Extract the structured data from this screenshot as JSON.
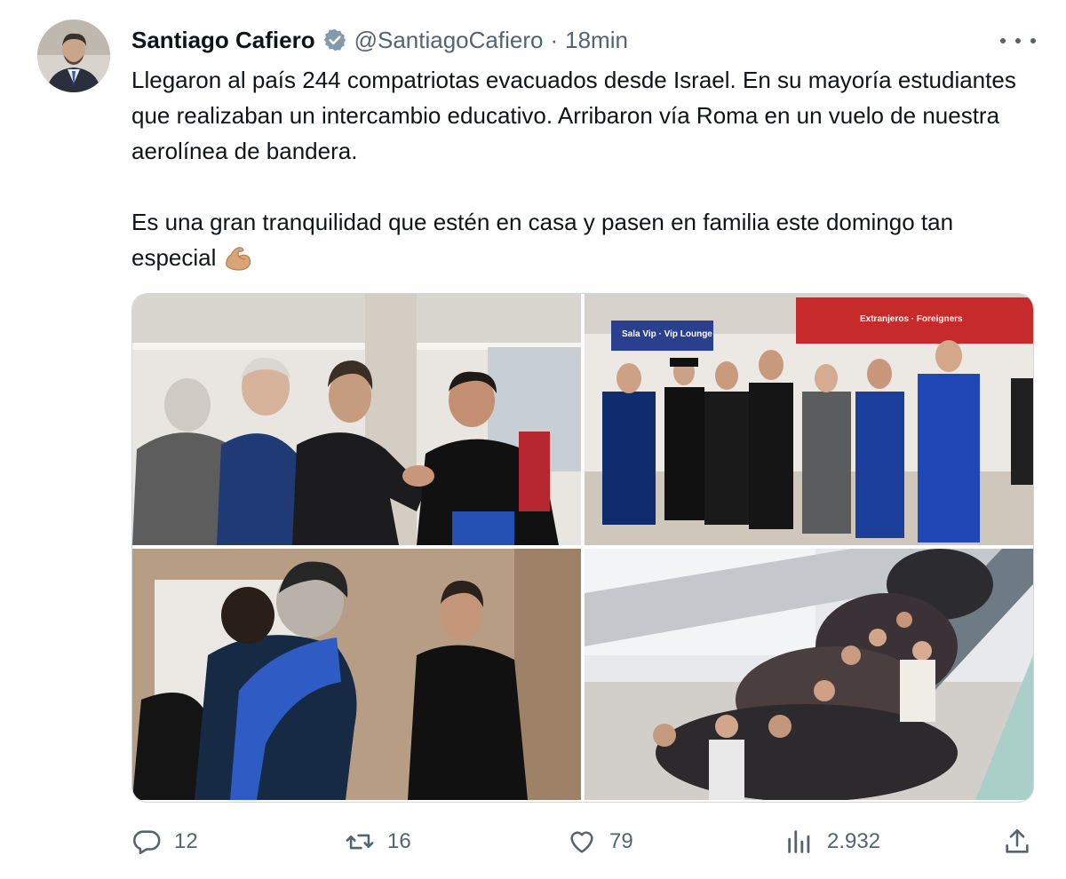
{
  "author": {
    "name": "Santiago Cafiero",
    "handle": "@SantiagoCafiero",
    "separator": "·",
    "time": "18min"
  },
  "icons": {
    "verified": "verified-badge-icon",
    "more": "more-options-icon",
    "emoji": "flexed-biceps-emoji",
    "reply": "reply-icon",
    "retweet": "retweet-icon",
    "like": "like-icon",
    "views": "views-icon",
    "share": "share-icon"
  },
  "tweet": {
    "paragraph_1": "Llegaron al país 244 compatriotas evacuados desde Israel. En su mayoría estudiantes que realizaban un intercambio educativo. Arribaron vía Roma en un vuelo de nuestra aerolínea de bandera.",
    "paragraph_2": "Es una gran tranquilidad que estén en casa y pasen en familia este domingo tan especial"
  },
  "media": {
    "sign_vip": "Sala Vip · Vip Lounge",
    "sign_extranjeros": "Extranjeros · Foreigners"
  },
  "metrics": {
    "replies": "12",
    "retweets": "16",
    "likes": "79",
    "views": "2.932"
  },
  "colors": {
    "text": "#0f1419",
    "secondary": "#536471",
    "verified": "#829aab",
    "sign_red": "#c62a2a",
    "sign_blue": "#2b3f8f"
  }
}
